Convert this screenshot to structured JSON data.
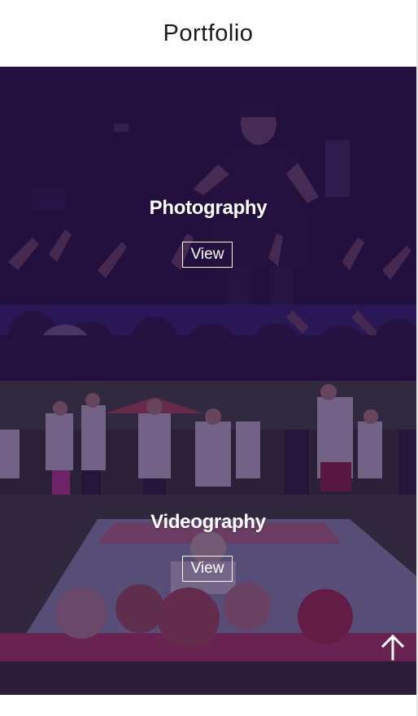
{
  "header": {
    "title": "Portfolio"
  },
  "portfolio": {
    "items": [
      {
        "title": "Photography",
        "view_label": "View"
      },
      {
        "title": "Videography",
        "view_label": "View"
      }
    ]
  },
  "colors": {
    "overlay": "#2a1247",
    "overlay_alpha": 0.82,
    "text": "#ffffff"
  },
  "icons": {
    "scroll_top": "arrow-up-icon"
  }
}
